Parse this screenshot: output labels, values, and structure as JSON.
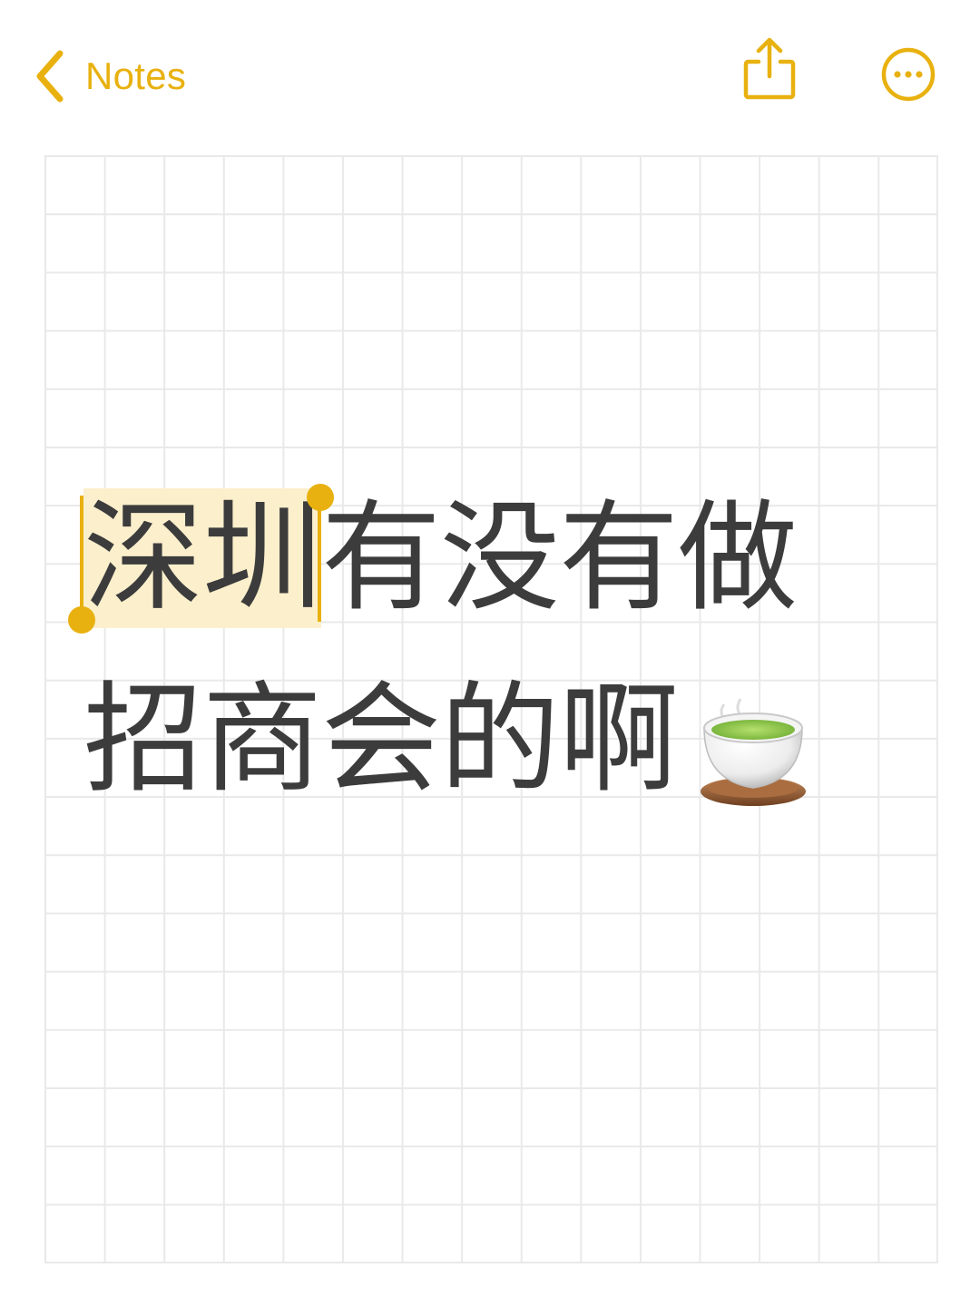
{
  "nav": {
    "back_label": "Notes",
    "icons": [
      "chevron-left-icon",
      "share-icon",
      "more-icon"
    ]
  },
  "note": {
    "line1_selected": "深圳",
    "line1_rest": "有没有做",
    "line2": "招商会的啊",
    "emoji": "teacup-without-handle"
  },
  "colors": {
    "accent": "#E8B10F",
    "selection": "#FBEFCC",
    "text": "#3C3C3C",
    "grid": "#E9E9E9",
    "tea": "#8CCB4A"
  }
}
